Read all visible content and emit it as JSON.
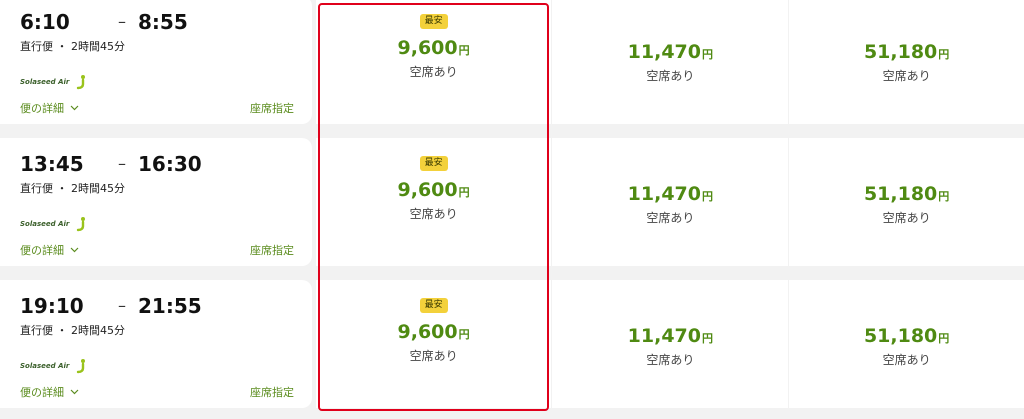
{
  "flights": [
    {
      "departure": "6:10",
      "arrival": "8:55",
      "dash": "–",
      "meta": "直行便 ・ 2時間45分",
      "airline": "Solaseed Air",
      "details_label": "便の詳細",
      "seat_label": "座席指定",
      "fares": [
        {
          "badge": "最安",
          "price": "9,600",
          "unit": "円",
          "availability": "空席あり"
        },
        {
          "badge": "",
          "price": "11,470",
          "unit": "円",
          "availability": "空席あり"
        },
        {
          "badge": "",
          "price": "51,180",
          "unit": "円",
          "availability": "空席あり"
        }
      ]
    },
    {
      "departure": "13:45",
      "arrival": "16:30",
      "dash": "–",
      "meta": "直行便 ・ 2時間45分",
      "airline": "Solaseed Air",
      "details_label": "便の詳細",
      "seat_label": "座席指定",
      "fares": [
        {
          "badge": "最安",
          "price": "9,600",
          "unit": "円",
          "availability": "空席あり"
        },
        {
          "badge": "",
          "price": "11,470",
          "unit": "円",
          "availability": "空席あり"
        },
        {
          "badge": "",
          "price": "51,180",
          "unit": "円",
          "availability": "空席あり"
        }
      ]
    },
    {
      "departure": "19:10",
      "arrival": "21:55",
      "dash": "–",
      "meta": "直行便 ・ 2時間45分",
      "airline": "Solaseed Air",
      "details_label": "便の詳細",
      "seat_label": "座席指定",
      "fares": [
        {
          "badge": "最安",
          "price": "9,600",
          "unit": "円",
          "availability": "空席あり"
        },
        {
          "badge": "",
          "price": "11,470",
          "unit": "円",
          "availability": "空席あり"
        },
        {
          "badge": "",
          "price": "51,180",
          "unit": "円",
          "availability": "空席あり"
        }
      ]
    }
  ],
  "colors": {
    "price_green": "#4f8a12",
    "link_green": "#5b8c1e",
    "badge_yellow": "#f3d13b",
    "highlight_red": "#e0001b"
  },
  "icons": {
    "logo": "solaseed-logo-icon",
    "chevron": "chevron-down-icon"
  }
}
